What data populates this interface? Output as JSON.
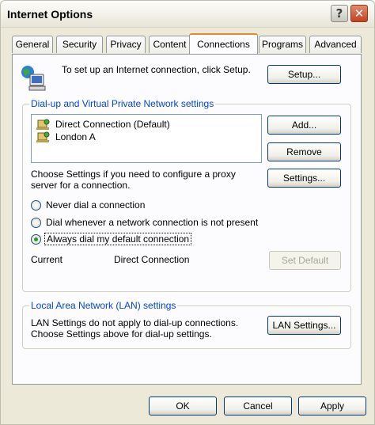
{
  "window": {
    "title": "Internet Options"
  },
  "titlebar_buttons": {
    "help": "?",
    "close": "✕"
  },
  "tabs": [
    {
      "label": "General"
    },
    {
      "label": "Security"
    },
    {
      "label": "Privacy"
    },
    {
      "label": "Content"
    },
    {
      "label": "Connections"
    },
    {
      "label": "Programs"
    },
    {
      "label": "Advanced"
    }
  ],
  "setup": {
    "text": "To set up an Internet connection, click Setup.",
    "button": "Setup..."
  },
  "dialup": {
    "title": "Dial-up and Virtual Private Network settings",
    "connections": [
      {
        "name": "Direct Connection (Default)"
      },
      {
        "name": "London A"
      }
    ],
    "add_button": "Add...",
    "remove_button": "Remove",
    "settings_text": "Choose Settings if you need to configure a proxy server for a connection.",
    "settings_button": "Settings...",
    "options": [
      {
        "label": "Never dial a connection",
        "selected": false
      },
      {
        "label": "Dial whenever a network connection is not present",
        "selected": false
      },
      {
        "label": "Always dial my default connection",
        "selected": true
      }
    ],
    "current_label": "Current",
    "current_value": "Direct Connection",
    "set_default_button": "Set Default"
  },
  "lan": {
    "title": "Local Area Network (LAN) settings",
    "text": "LAN Settings do not apply to dial-up connections. Choose Settings above for dial-up settings.",
    "button": "LAN Settings..."
  },
  "footer": {
    "ok": "OK",
    "cancel": "Cancel",
    "apply": "Apply"
  }
}
